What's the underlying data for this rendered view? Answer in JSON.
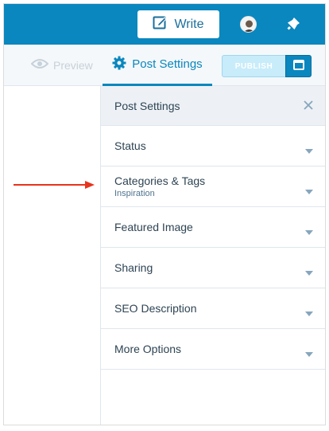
{
  "masterbar": {
    "write_label": "Write",
    "background": "#0a87be"
  },
  "toolbar": {
    "preview_label": "Preview",
    "settings_label": "Post Settings",
    "publish_label": "PUBLISH"
  },
  "panel": {
    "title": "Post Settings",
    "sections": [
      {
        "label": "Status"
      },
      {
        "label": "Categories & Tags",
        "sub": "Inspiration"
      },
      {
        "label": "Featured Image"
      },
      {
        "label": "Sharing"
      },
      {
        "label": "SEO Description"
      },
      {
        "label": "More Options"
      }
    ]
  },
  "icons": [
    "write-icon",
    "avatar",
    "notifications-icon",
    "eye-icon",
    "gear-icon",
    "calendar-icon",
    "close-icon",
    "chevron-down-icon"
  ],
  "colors": {
    "accent": "#0a87be",
    "arrow": "#e8341c",
    "text": "#2e4453"
  }
}
